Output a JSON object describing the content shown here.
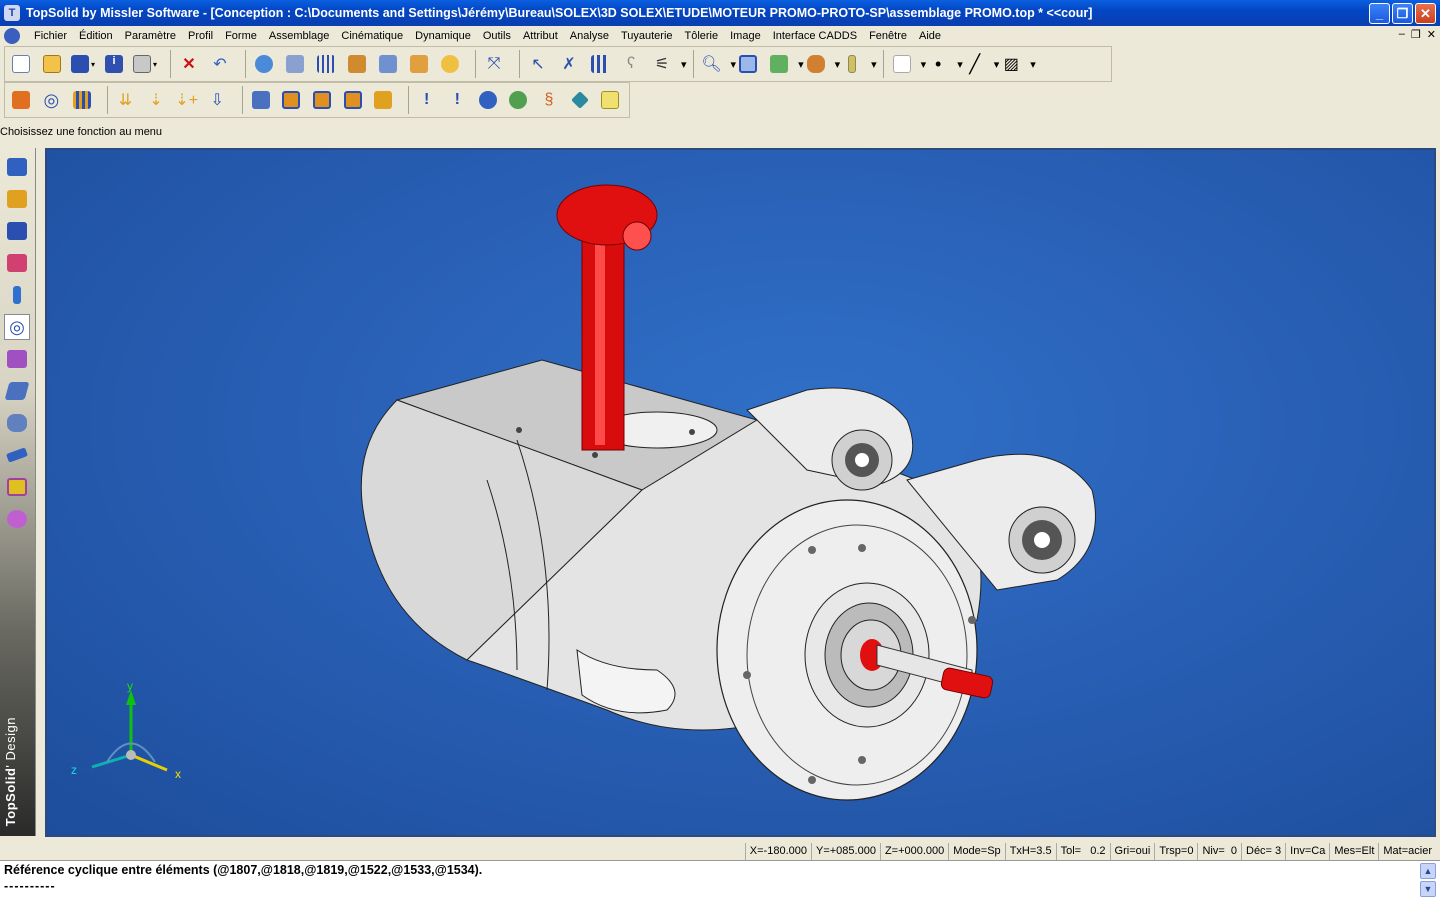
{
  "window": {
    "title": "TopSolid by Missler Software - [Conception : C:\\Documents and Settings\\Jérémy\\Bureau\\SOLEX\\3D SOLEX\\ETUDE\\MOTEUR PROMO-PROTO-SP\\assemblage PROMO.top *  <<cour]",
    "minimize": "_",
    "restore": "❐",
    "close": "✕"
  },
  "menu": {
    "items": [
      "Fichier",
      "Édition",
      "Paramètre",
      "Profil",
      "Forme",
      "Assemblage",
      "Cinématique",
      "Dynamique",
      "Outils",
      "Attribut",
      "Analyse",
      "Tuyauterie",
      "Tôlerie",
      "Image",
      "Interface CADDS",
      "Fenêtre",
      "Aide"
    ],
    "mdi_minimize": "–",
    "mdi_restore": "❐",
    "mdi_close": "✕"
  },
  "prompt": "Choisissez une fonction au menu",
  "brand": {
    "name": "TopSolid",
    "sub": "' Design"
  },
  "axes": {
    "x": "x",
    "y": "y",
    "z": "z"
  },
  "status": {
    "x": "X=-180.000",
    "y": "Y=+085.000",
    "z": "Z=+000.000",
    "mode": "Mode=Sp",
    "txh": "TxH=3.5",
    "tol": "Tol=   0.2",
    "gri": "Gri=oui",
    "trsp": "Trsp=0",
    "niv": "Niv=  0",
    "dec": "Déc= 3",
    "inv": "Inv=Ca",
    "mes": "Mes=Elt",
    "mat": "Mat=acier"
  },
  "messages": {
    "line1": "Référence cyclique entre éléments (@1807,@1818,@1819,@1522,@1533,@1534).",
    "line2": "----------"
  },
  "colors": {
    "viewport_bg": "#2a62b8",
    "part_red": "#e01010",
    "part_grey": "#e8e8e8",
    "title_blue": "#0a4fd0"
  }
}
